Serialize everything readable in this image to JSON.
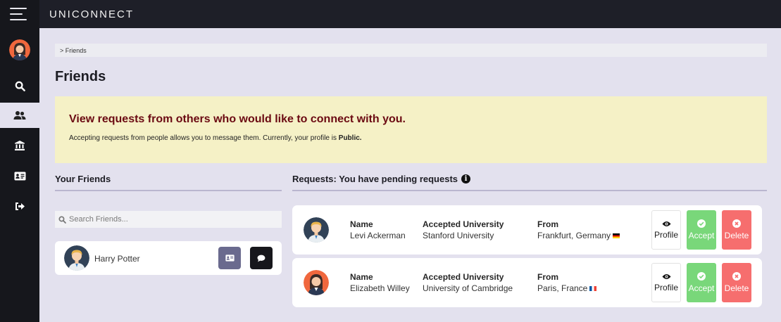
{
  "app": {
    "brand": "UNICONNECT"
  },
  "sidebar": {
    "items": [
      {
        "icon": "search-icon"
      },
      {
        "icon": "users-icon",
        "active": true
      },
      {
        "icon": "university-icon"
      },
      {
        "icon": "id-card-icon"
      },
      {
        "icon": "sign-out-icon"
      }
    ]
  },
  "breadcrumb": "> Friends",
  "page": {
    "title": "Friends"
  },
  "alert": {
    "title": "View requests from others who would like to connect with you.",
    "body_prefix": "Accepting requests from people allows you to message them. Currently, your profile is ",
    "visibility": "Public."
  },
  "friends": {
    "heading": "Your Friends",
    "search_placeholder": "Search Friends...",
    "list": [
      {
        "name": "Harry Potter"
      }
    ]
  },
  "requests": {
    "heading": "Requests: You have pending requests",
    "labels": {
      "name": "Name",
      "university": "Accepted University",
      "from": "From"
    },
    "actions": {
      "profile": "Profile",
      "accept": "Accept",
      "delete": "Delete"
    },
    "items": [
      {
        "name": "Levi Ackerman",
        "university": "Stanford University",
        "from": "Frankfurt, Germany",
        "flag": "de"
      },
      {
        "name": "Elizabeth Willey",
        "university": "University of Cambridge",
        "from": "Paris, France",
        "flag": "fr"
      }
    ]
  },
  "colors": {
    "sidebar": "#16171c",
    "topbar": "#1e1f28",
    "background": "#e3e1ee",
    "alert_bg": "#f5f1c6",
    "alert_title": "#6b0a12",
    "accept": "#79d77a",
    "delete": "#f66e6e"
  }
}
